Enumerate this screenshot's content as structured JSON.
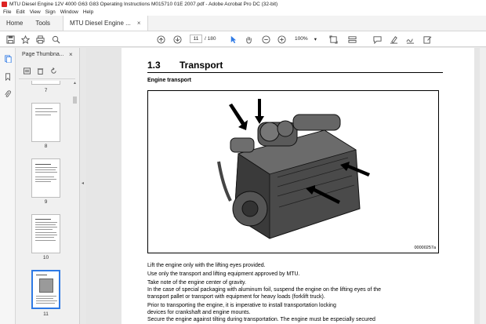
{
  "window": {
    "title": "MTU Diesel Engine 12V 4000 G63 G83 Operating Instructions M015710 01E 2007.pdf - Adobe Acrobat Pro DC (32-bit)"
  },
  "menu": [
    "File",
    "Edit",
    "View",
    "Sign",
    "Window",
    "Help"
  ],
  "tabs": {
    "home": "Home",
    "tools": "Tools",
    "document": "MTU Diesel Engine ...",
    "close_glyph": "×"
  },
  "toolbar": {
    "current_page": "11",
    "total_pages": "/ 180",
    "zoom": "100%",
    "icons": [
      "save-icon",
      "bookmark-star-icon",
      "print-icon",
      "search-icon",
      "page-up-icon",
      "page-down-icon",
      "select-arrow-icon",
      "hand-icon",
      "zoom-out-icon",
      "zoom-in-icon",
      "fit-page-icon",
      "page-display-icon",
      "comment-icon",
      "highlight-icon",
      "sign-icon",
      "fill-sign-icon"
    ]
  },
  "thumbnails": {
    "panel_title": "Page Thumbna...",
    "close_glyph": "×",
    "pages": [
      {
        "num": "7"
      },
      {
        "num": "8"
      },
      {
        "num": "9"
      },
      {
        "num": "10"
      },
      {
        "num": "11"
      }
    ]
  },
  "document": {
    "section_number": "1.3",
    "section_title": "Transport",
    "subheading": "Engine transport",
    "figure_code": "00000257a",
    "paragraphs": [
      "Lift the engine only with the lifting eyes provided.",
      "Use only the transport and lifting equipment approved by MTU.",
      "Take note of the engine center of gravity.",
      "In the case of special packaging with aluminum foil, suspend the engine on the lifting eyes of the",
      "transport pallet or transport with equipment for heavy loads (forklift truck).",
      "Prior to transporting the engine, it is imperative to install transportation locking",
      "devices for crankshaft and engine mounts.",
      "Secure the engine against tilting during transportation.  The engine must be especially secured"
    ]
  },
  "colors": {
    "accent": "#2f7ae5",
    "acrobat_red": "#d22222"
  }
}
